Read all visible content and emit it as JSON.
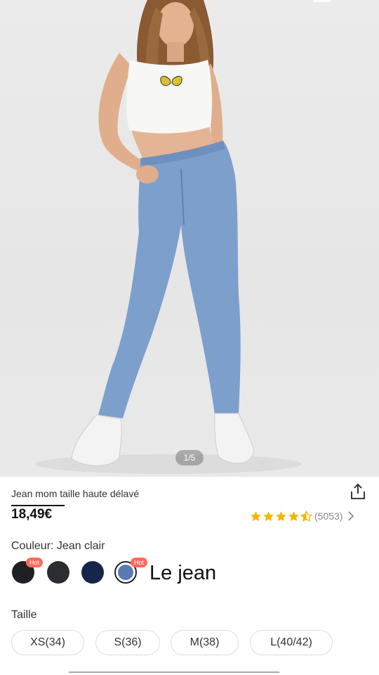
{
  "gallery": {
    "counter": "1/5"
  },
  "product": {
    "title": "Jean mom taille haute délavé",
    "price": "18,49€",
    "rating": 4.5,
    "reviews": "(5053)"
  },
  "color": {
    "label": "Couleur: Jean clair",
    "swatches": [
      {
        "name": "black",
        "color": "#1f2024",
        "hot": "Hot"
      },
      {
        "name": "dark-grey",
        "color": "#2c2d30",
        "hot": ""
      },
      {
        "name": "navy",
        "color": "#16264b",
        "hot": ""
      },
      {
        "name": "light-blue",
        "color": "#5b7ab3",
        "hot": "Hot",
        "selected": true
      }
    ]
  },
  "overlay_caption": "Le jean",
  "size": {
    "label": "Taille",
    "options": [
      "XS(34)",
      "S(36)",
      "M(38)",
      "L(40/42)"
    ]
  },
  "colors": {
    "star": "#f7b500",
    "hot_badge": "#ff6a5c"
  }
}
